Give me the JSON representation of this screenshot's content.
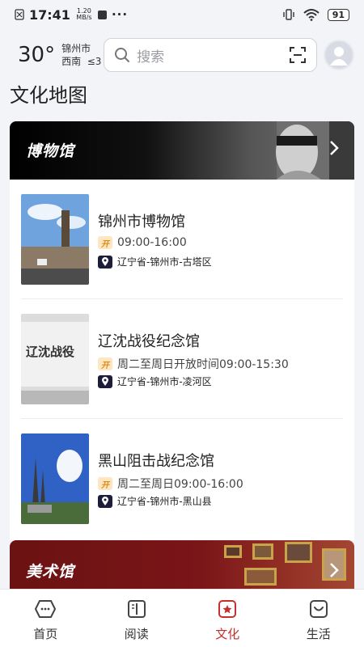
{
  "status_bar": {
    "time": "17:41",
    "net_speed_value": "1.20",
    "net_speed_unit": "MB/s",
    "more": "···",
    "battery": "91"
  },
  "header": {
    "temperature": "30°",
    "city": "锦州市",
    "wind": "西南",
    "wind_level": "≤3",
    "search_placeholder": "搜索"
  },
  "page_title": "文化地图",
  "museum_banner": {
    "label": "博物馆"
  },
  "museums": [
    {
      "name": "锦州市博物馆",
      "hours": "09:00-16:00",
      "address": "辽宁省-锦州市-古塔区"
    },
    {
      "name": "辽沈战役纪念馆",
      "hours": "周二至周日开放时间09:00-15:30",
      "address": "辽宁省-锦州市-凌河区"
    },
    {
      "name": "黑山阻击战纪念馆",
      "hours": "周二至周日09:00-16:00",
      "address": "辽宁省-锦州市-黑山县"
    }
  ],
  "open_badge": "开",
  "art_banner": {
    "label": "美术馆"
  },
  "tabs": [
    {
      "label": "首页",
      "icon": "home-icon"
    },
    {
      "label": "阅读",
      "icon": "book-icon"
    },
    {
      "label": "文化",
      "icon": "culture-icon",
      "active": true
    },
    {
      "label": "生活",
      "icon": "life-icon"
    }
  ],
  "colors": {
    "accent": "#c3312d",
    "badge_open": "#e08b16",
    "pin": "#1d1d3a"
  }
}
